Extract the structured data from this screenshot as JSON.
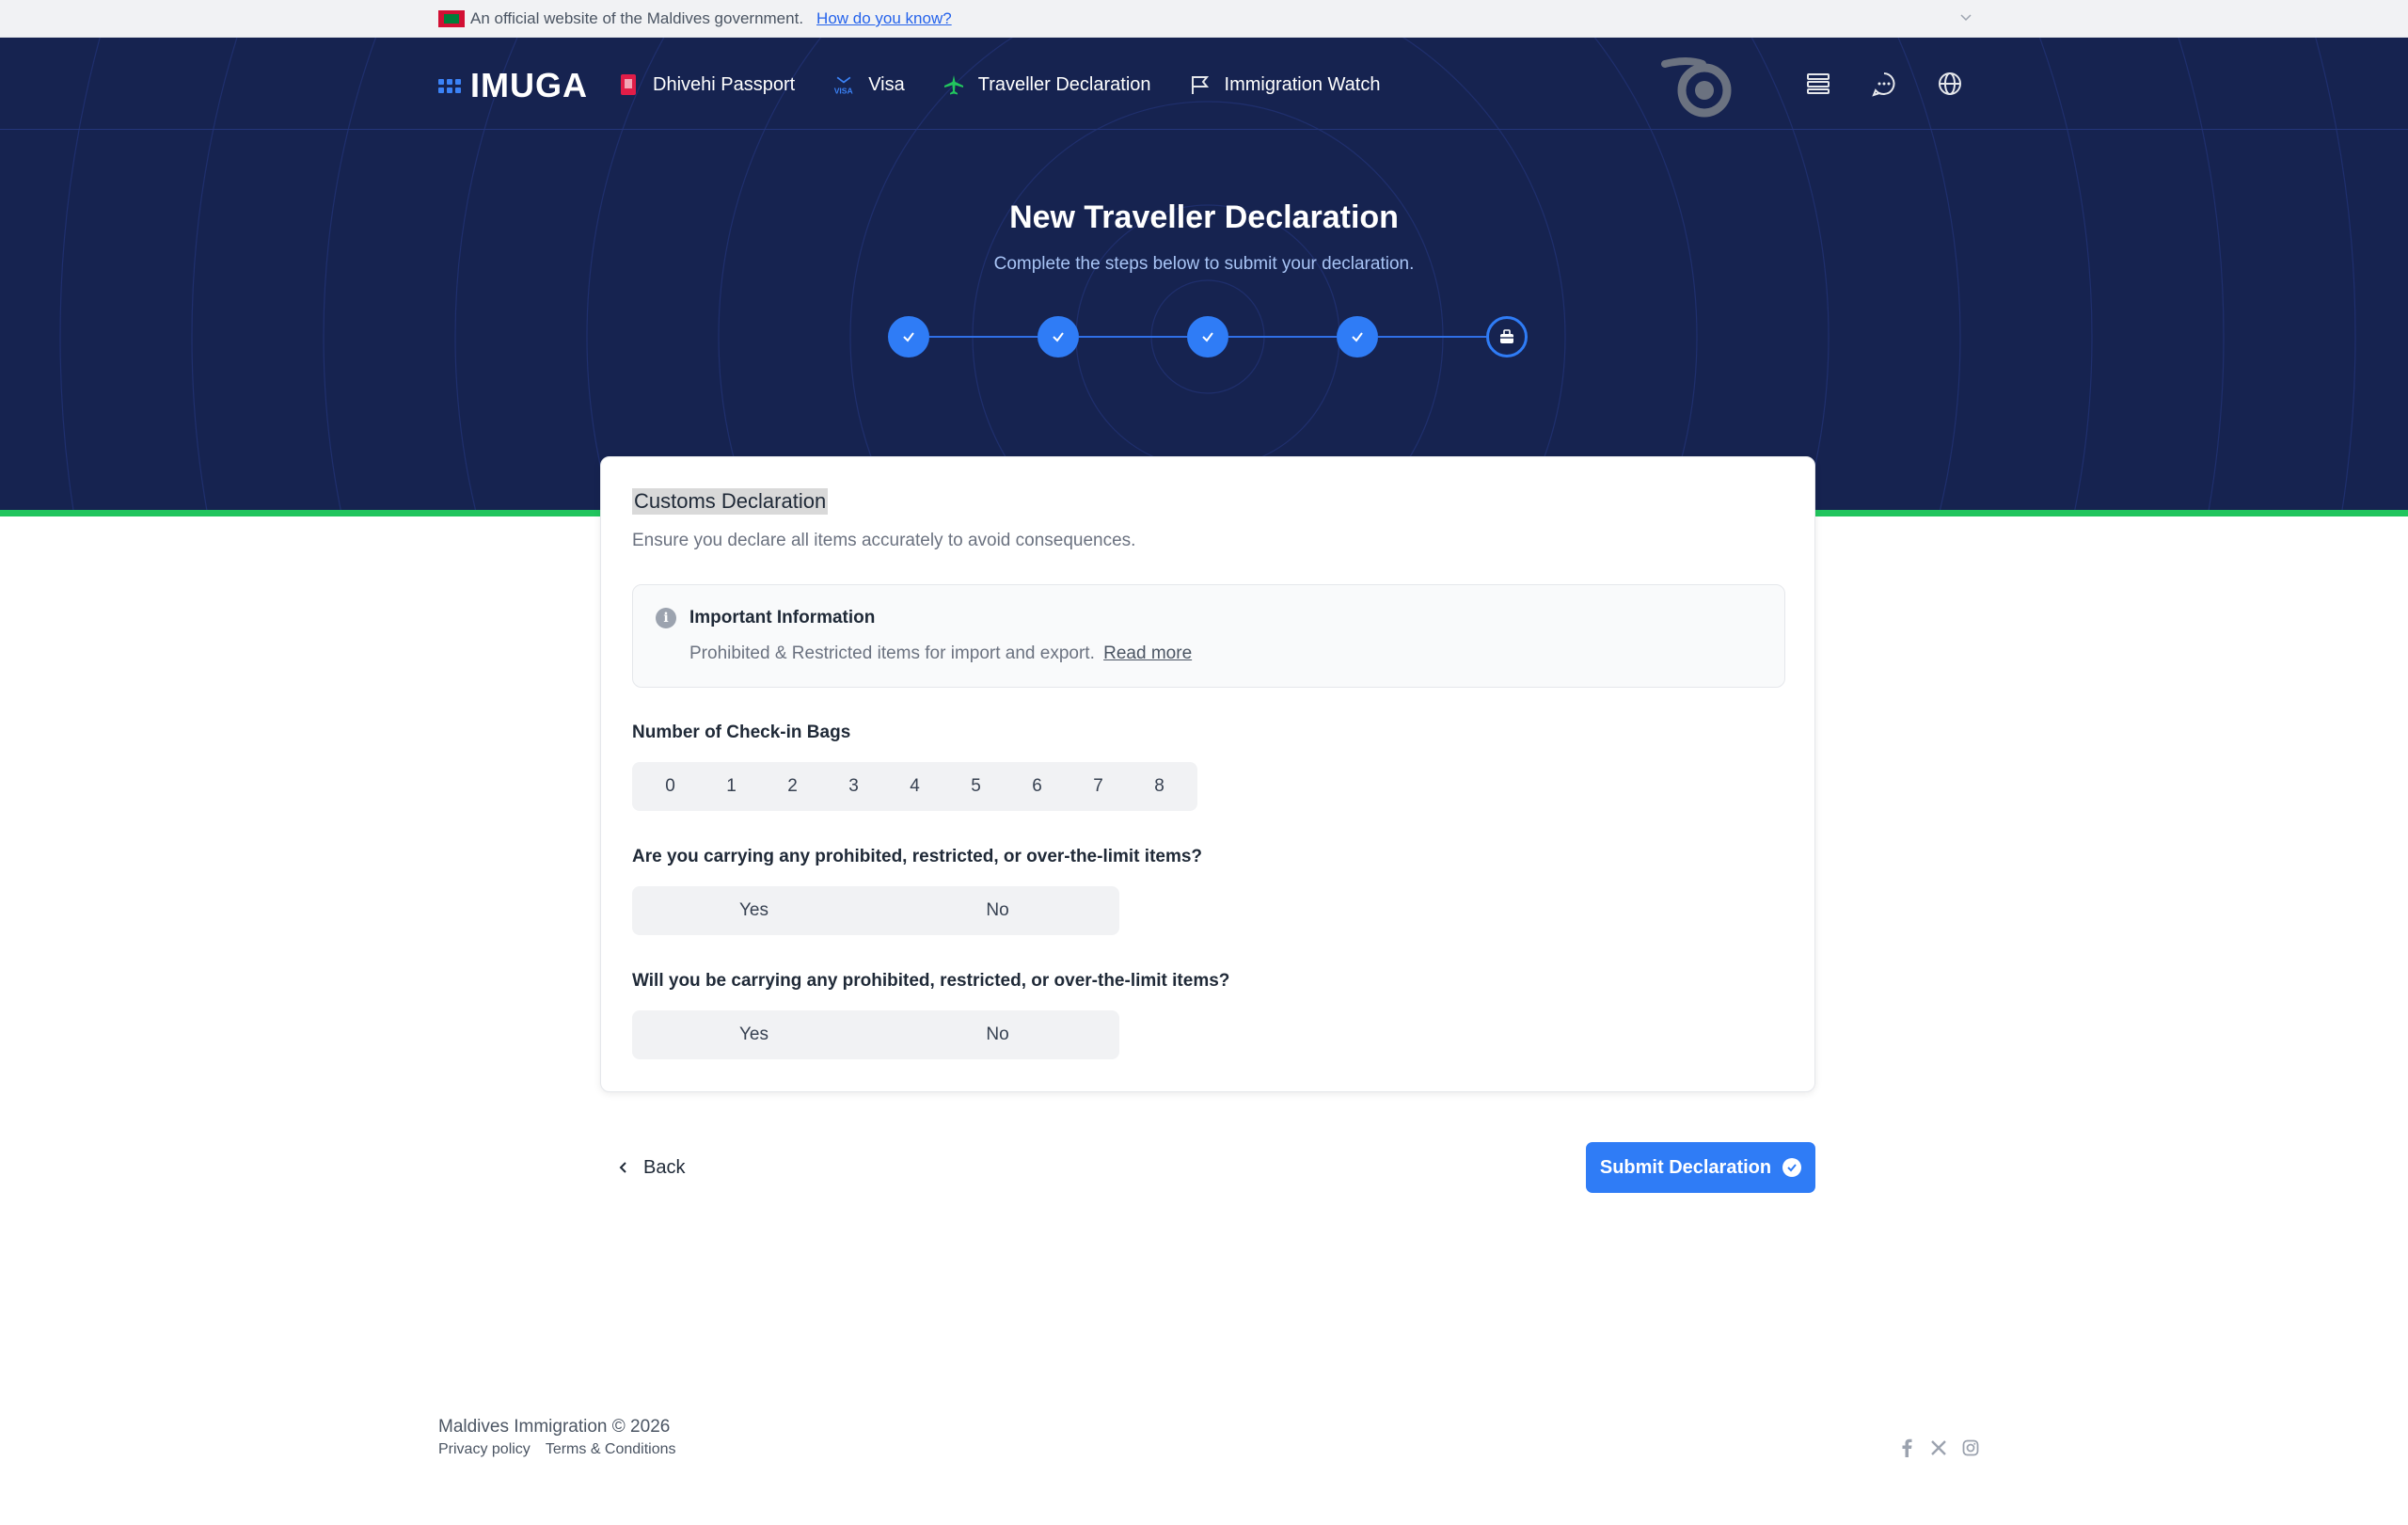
{
  "gov_banner": {
    "text": "An official website of the Maldives government.",
    "link": "How do you know?"
  },
  "nav": {
    "logo": "IMUGA",
    "items": [
      {
        "label": "Dhivehi Passport",
        "icon": "passport-icon"
      },
      {
        "label": "Visa",
        "icon": "visa-icon"
      },
      {
        "label": "Traveller Declaration",
        "icon": "airplane-icon"
      },
      {
        "label": "Immigration Watch",
        "icon": "flag-icon"
      }
    ],
    "right_icons": [
      "menu-list-icon",
      "chat-icon",
      "globe-icon"
    ]
  },
  "hero": {
    "title": "New Traveller Declaration",
    "subtitle": "Complete the steps below to submit your declaration.",
    "steps": [
      "complete",
      "complete",
      "complete",
      "complete",
      "current"
    ]
  },
  "card": {
    "title": "Customs Declaration",
    "subtitle": "Ensure you declare all items accurately to avoid consequences.",
    "info": {
      "title": "Important Information",
      "text": "Prohibited & Restricted items for import and export.",
      "link": "Read more"
    },
    "bags_label": "Number of Check-in Bags",
    "bags_options": [
      "0",
      "1",
      "2",
      "3",
      "4",
      "5",
      "6",
      "7",
      "8"
    ],
    "q1": {
      "label": "Are you carrying any prohibited, restricted, or over-the-limit items?",
      "yes": "Yes",
      "no": "No"
    },
    "q2": {
      "label": "Will you be carrying any prohibited, restricted, or over-the-limit items?",
      "yes": "Yes",
      "no": "No"
    }
  },
  "actions": {
    "back": "Back",
    "submit": "Submit Declaration"
  },
  "footer": {
    "copyright": "Maldives Immigration © 2026",
    "links": [
      "Privacy policy",
      "Terms & Conditions"
    ],
    "social": [
      "facebook-icon",
      "x-icon",
      "instagram-icon"
    ]
  },
  "colors": {
    "navy": "#162350",
    "accent_blue": "#2f7cf6",
    "green_stripe": "#22c55e"
  }
}
